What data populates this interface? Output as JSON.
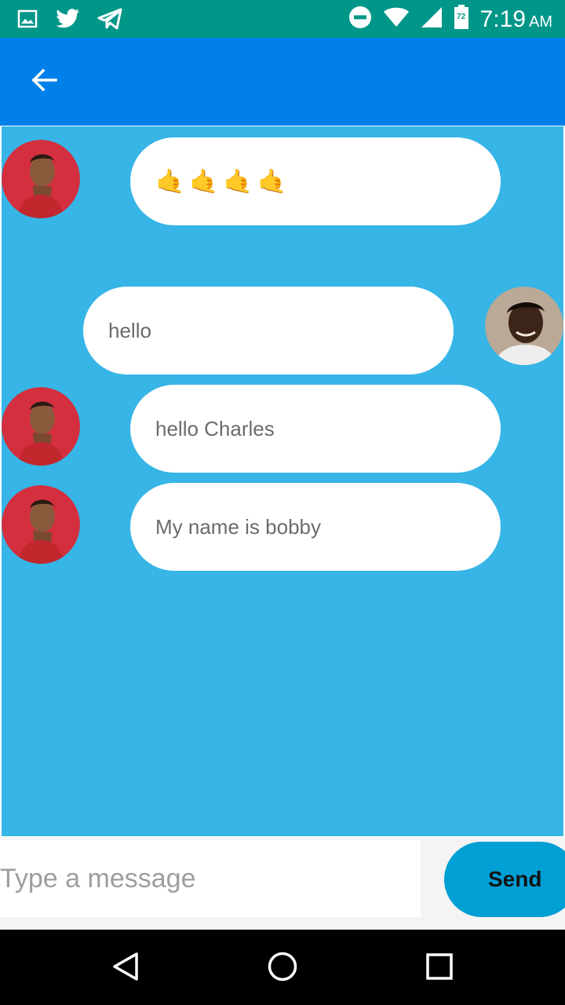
{
  "status_bar": {
    "time": "7:19",
    "ampm": "AM",
    "battery_level": "72",
    "icons_left": [
      "image-icon",
      "twitter-icon",
      "telegram-icon"
    ],
    "icons_right": [
      "do-not-disturb-icon",
      "wifi-icon",
      "signal-icon",
      "battery-icon"
    ]
  },
  "app_bar": {
    "back_icon": "arrow-back-icon"
  },
  "messages": [
    {
      "sender": "bobby",
      "side": "left",
      "text": "",
      "emoji": [
        "🤙",
        "🤙",
        "🤙",
        "🤙"
      ]
    },
    {
      "sender": "me",
      "side": "right",
      "text": "hello"
    },
    {
      "sender": "bobby",
      "side": "left",
      "text": "hello Charles"
    },
    {
      "sender": "bobby",
      "side": "left",
      "text": "My name is bobby"
    }
  ],
  "composer": {
    "placeholder": "Type a message",
    "value": "",
    "send_label": "Send"
  },
  "nav_bar": {
    "icons": [
      "back-triangle-icon",
      "home-circle-icon",
      "recents-square-icon"
    ]
  },
  "colors": {
    "status_bar": "#009688",
    "app_bar": "#0080e8",
    "chat_background": "#36b5e6",
    "send_button": "#009fd4",
    "bubble": "#ffffff"
  }
}
